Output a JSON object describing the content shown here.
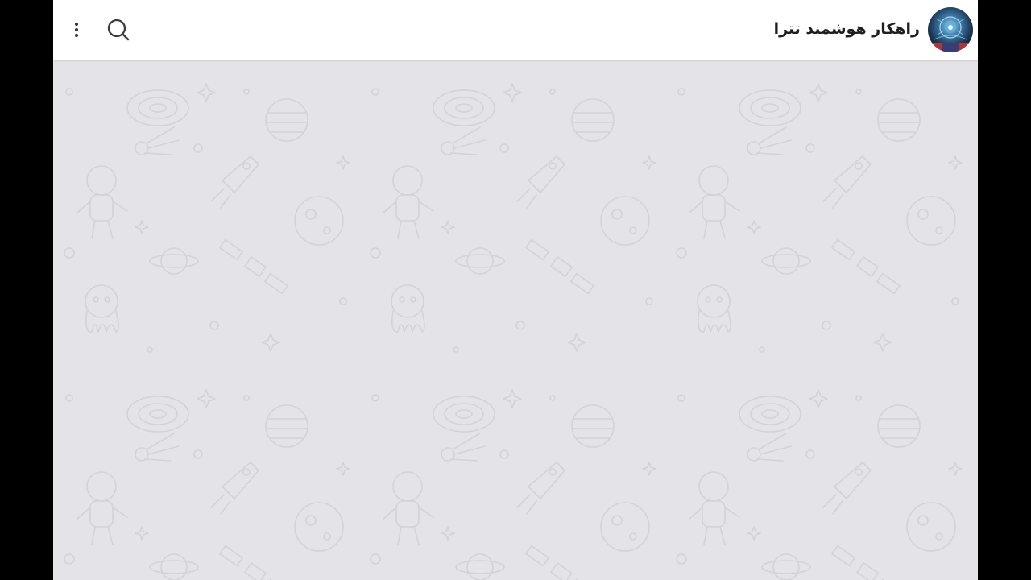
{
  "header": {
    "title": "راهکار هوشمند تترا",
    "menu_icon": "more-vertical-icon",
    "search_icon": "search-icon",
    "avatar_icon": "channel-avatar"
  },
  "chat": {
    "wallpaper": "space-doodle-pattern"
  },
  "colors": {
    "header_bg": "#ffffff",
    "chat_bg": "#e4e3e7",
    "doodle_stroke": "#d4d3d8",
    "letterbox": "#000000"
  }
}
